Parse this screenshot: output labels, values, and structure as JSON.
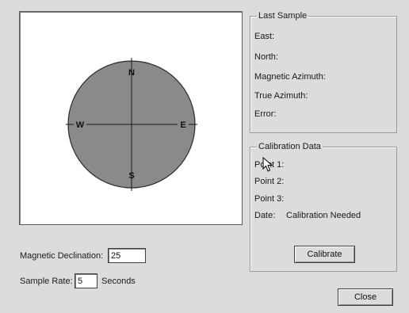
{
  "compass": {
    "north": "N",
    "south": "S",
    "east": "E",
    "west": "W",
    "face_color": "#8a8a8a"
  },
  "last_sample": {
    "title": "Last Sample",
    "east_label": "East:",
    "north_label": "North:",
    "magnetic_azimuth_label": "Magnetic Azimuth:",
    "true_azimuth_label": "True Azimuth:",
    "error_label": "Error:"
  },
  "calibration": {
    "title": "Calibration Data",
    "point1_label": "Point 1:",
    "point2_label": "Point 2:",
    "point3_label": "Point 3:",
    "date_label": "Date:",
    "date_value": "Calibration Needed",
    "calibrate_button": "Calibrate"
  },
  "settings": {
    "declination_label": "Magnetic Declination:",
    "declination_value": "25",
    "sample_rate_label": "Sample Rate:",
    "sample_rate_value": "5",
    "sample_rate_unit": "Seconds"
  },
  "close_button": "Close"
}
